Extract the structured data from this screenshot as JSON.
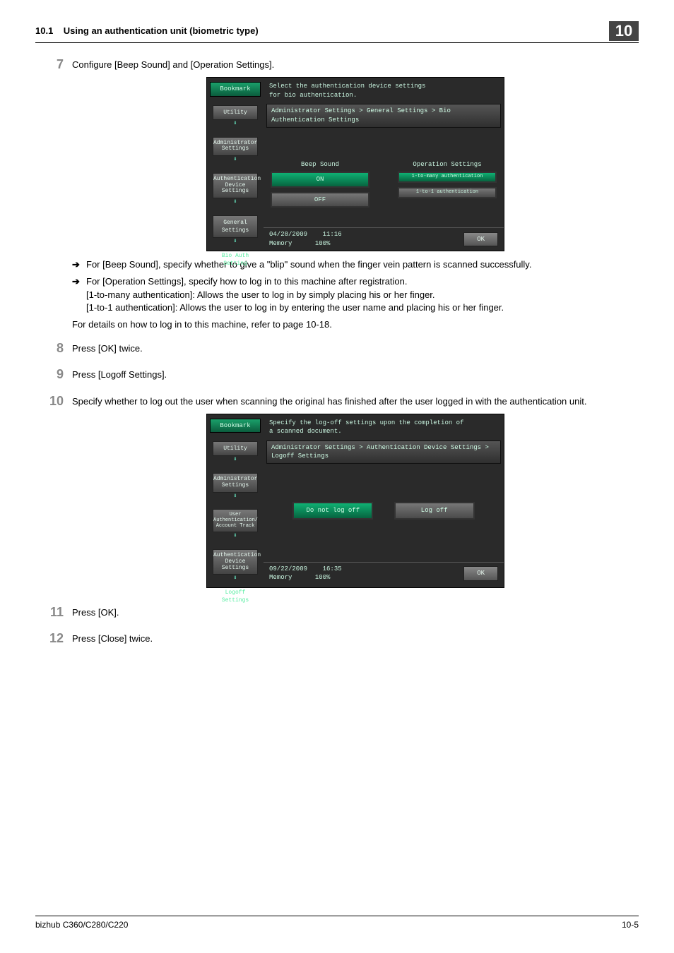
{
  "header": {
    "section_number": "10.1",
    "section_title": "Using an authentication unit (biometric type)",
    "chapter_badge": "10"
  },
  "steps": {
    "s7": {
      "num": "7",
      "text": "Configure [Beep Sound] and [Operation Settings].",
      "sub1": "For [Beep Sound], specify whether to give a \"blip\" sound when the finger vein pattern is scanned successfully.",
      "sub2a": "For [Operation Settings], specify how to log in to this machine after registration.",
      "sub2b": "[1-to-many authentication]: Allows the user to log in by simply placing his or her finger.",
      "sub2c": "[1-to-1 authentication]: Allows the user to log in by entering the user name and placing his or her finger.",
      "tail": "For details on how to log in to this machine, refer to page 10-18."
    },
    "s8": {
      "num": "8",
      "text": "Press [OK] twice."
    },
    "s9": {
      "num": "9",
      "text": "Press [Logoff Settings]."
    },
    "s10": {
      "num": "10",
      "text": "Specify whether to log out the user when scanning the original has finished after the user logged in with the authentication unit."
    },
    "s11": {
      "num": "11",
      "text": "Press [OK]."
    },
    "s12": {
      "num": "12",
      "text": "Press [Close] twice."
    }
  },
  "ss1": {
    "instr1": "Select the authentication device settings",
    "instr2": "for bio authentication.",
    "crumb": "Administrator Settings > General Settings > Bio Authentication Settings",
    "bookmark": "Bookmark",
    "nav": {
      "utility": "Utility",
      "admin": "Administrator Settings",
      "authdev": "Authentication Device Settings",
      "general": "General Settings",
      "bio": "Bio Auth Setting"
    },
    "col1_label": "Beep Sound",
    "col2_label": "Operation Settings",
    "on": "ON",
    "off": "OFF",
    "opt_many": "1-to-many authentication",
    "opt_one": "1-to-1 authentication",
    "date": "04/28/2009",
    "time": "11:16",
    "mem": "Memory",
    "pct": "100%",
    "ok": "OK"
  },
  "ss2": {
    "instr1": "Specify the log-off settings upon the completion of",
    "instr2": "a scanned document.",
    "crumb": "Administrator Settings > Authentication Device Settings > Logoff Settings",
    "bookmark": "Bookmark",
    "nav": {
      "utility": "Utility",
      "admin": "Administrator Settings",
      "usertrack": "User Authentication/ Account Track",
      "authdev": "Authentication Device Settings",
      "logoff": "Logoff Settings"
    },
    "opt_keep": "Do not log off",
    "opt_log": "Log off",
    "date": "09/22/2009",
    "time": "16:35",
    "mem": "Memory",
    "pct": "100%",
    "ok": "OK"
  },
  "footer": {
    "model": "bizhub C360/C280/C220",
    "pagenum": "10-5"
  }
}
